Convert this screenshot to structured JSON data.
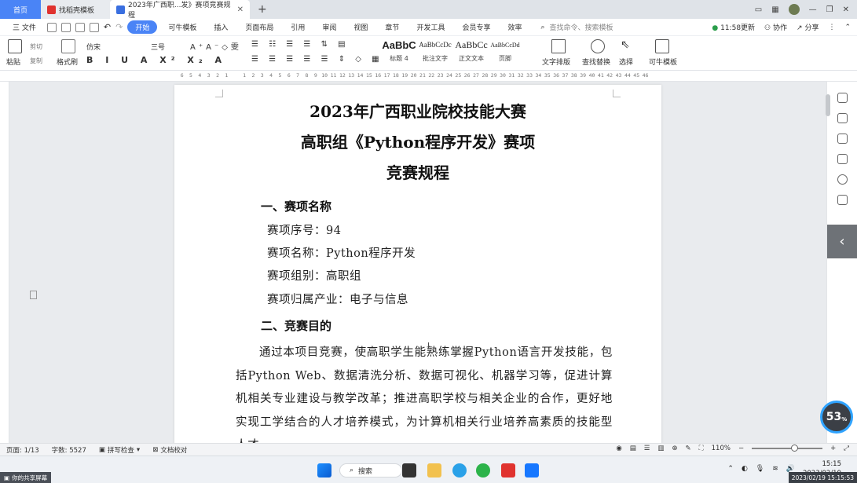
{
  "tabs": {
    "home": "首页",
    "daoke": "找稻壳模板",
    "doc": "2023年广西职...发》赛项竞赛规程",
    "close": "✕",
    "plus": "+"
  },
  "menubar": {
    "file": "三 文件",
    "items": [
      "开始",
      "可牛模板",
      "插入",
      "页面布局",
      "引用",
      "审阅",
      "视图",
      "章节",
      "开发工具",
      "会员专享",
      "效率"
    ],
    "search_placeholder": "查找命令、搜索模板",
    "update": "11:58更新",
    "collab": "协作",
    "share": "分享"
  },
  "ribbon": {
    "paste": "粘贴",
    "cut": "剪切",
    "copy": "复制",
    "format_painter": "格式刷",
    "font": "仿宋",
    "size": "三号",
    "styles": [
      {
        "sample": "AaBbC",
        "label": "标题 4"
      },
      {
        "sample": "AaBbCcDc",
        "label": "批注文字"
      },
      {
        "sample": "AaBbCc",
        "label": "正文文本"
      },
      {
        "sample": "AaBbCcDd",
        "label": "页脚"
      }
    ],
    "text_layout": "文字排版",
    "find_replace": "查找替换",
    "select": "选择",
    "keniu": "可牛模板"
  },
  "ruler": [
    "6",
    "5",
    "4",
    "3",
    "2",
    "1",
    "",
    "1",
    "2",
    "3",
    "4",
    "5",
    "6",
    "7",
    "8",
    "9",
    "10",
    "11",
    "12",
    "13",
    "14",
    "15",
    "16",
    "17",
    "18",
    "19",
    "20",
    "21",
    "22",
    "23",
    "24",
    "25",
    "26",
    "27",
    "28",
    "29",
    "30",
    "31",
    "32",
    "33",
    "34",
    "35",
    "36",
    "37",
    "38",
    "39",
    "40",
    "41",
    "42",
    "43",
    "44",
    "45",
    "46"
  ],
  "document": {
    "title1": "2023年广西职业院校技能大赛",
    "title2": "高职组《Python程序开发》赛项",
    "title3": "竞赛规程",
    "section1": "一、赛项名称",
    "items": [
      "赛项序号：94",
      "赛项名称：Python程序开发",
      "赛项组别：高职组",
      "赛项归属产业：电子与信息"
    ],
    "section2": "二、竞赛目的",
    "paragraph": "通过本项目竞赛，使高职学生能熟练掌握Python语言开发技能，包括Python Web、数据清洗分析、数据可视化、机器学习等，促进计算机相关专业建设与教学改革；推进高职学校与相关企业的合作，更好地实现工学结合的人才培养模式，为计算机相关行业培养高素质的技能型人才。"
  },
  "progress": {
    "value": "53",
    "unit": "%"
  },
  "status": {
    "page": "页面: 1/13",
    "words": "字数: 5527",
    "spell": "拼写检查",
    "proof": "文档校对",
    "zoom": "110%",
    "zoom_value": 110
  },
  "taskbar": {
    "search": "搜索",
    "time": "15:15",
    "date": "2023/02/19",
    "share": "你的共享屏幕",
    "timestamp": "2023/02/19 15:15:53"
  },
  "colors": {
    "accent": "#4a84f6",
    "tabbar": "#dfe3e8",
    "wps_red": "#e0332f"
  }
}
